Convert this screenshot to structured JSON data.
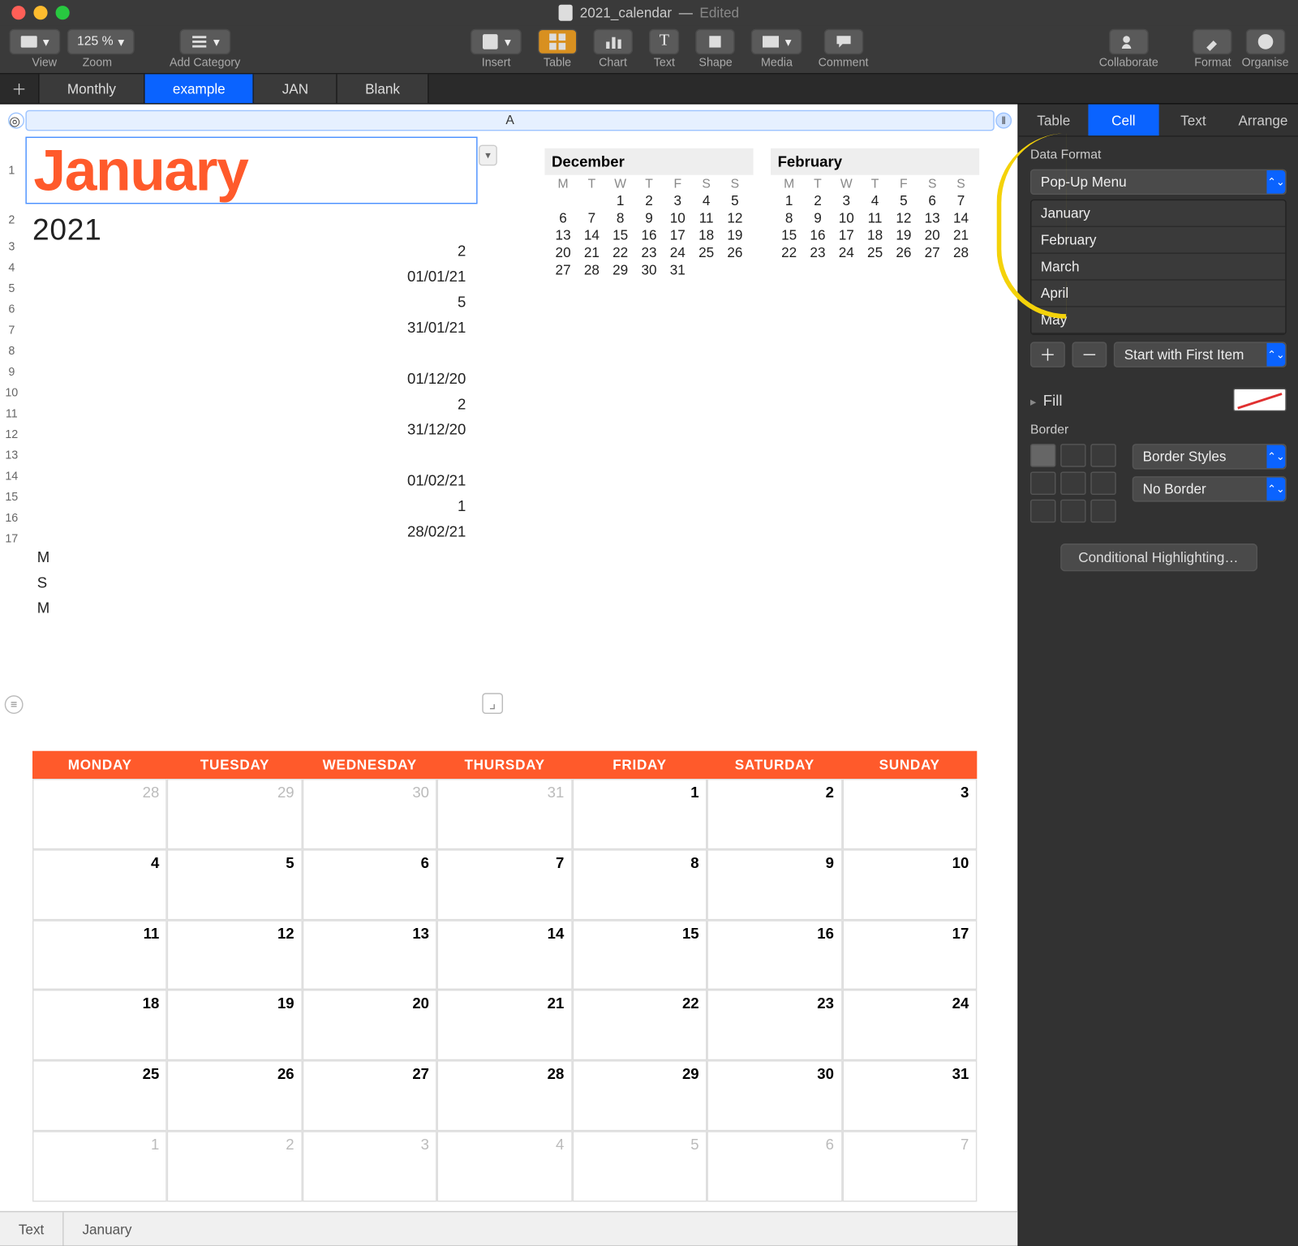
{
  "title": {
    "filename": "2021_calendar",
    "edited": "Edited"
  },
  "toolbar": {
    "view": "View",
    "zoom": "Zoom",
    "zoom_val": "125 %",
    "add_category": "Add Category",
    "insert": "Insert",
    "table": "Table",
    "chart": "Chart",
    "text": "Text",
    "shape": "Shape",
    "media": "Media",
    "comment": "Comment",
    "collaborate": "Collaborate",
    "format": "Format",
    "organise": "Organise"
  },
  "sheets": {
    "items": [
      "Monthly",
      "example",
      "JAN",
      "Blank"
    ],
    "active_index": 1
  },
  "inspector": {
    "tabs": [
      "Table",
      "Cell",
      "Text",
      "Arrange"
    ],
    "active": 1,
    "data_format": "Data Format",
    "format_value": "Pop-Up Menu",
    "options": [
      "January",
      "February",
      "March",
      "April",
      "May"
    ],
    "start_with": "Start with First Item",
    "fill": "Fill",
    "border": "Border",
    "border_styles": "Border Styles",
    "no_border": "No Border",
    "conditional": "Conditional Highlighting…"
  },
  "canvas": {
    "col_letter": "A",
    "cell_title": "January",
    "year": "2021",
    "rows": [
      {
        "n": "3",
        "v": "2"
      },
      {
        "n": "4",
        "v": "01/01/21"
      },
      {
        "n": "5",
        "v": "5"
      },
      {
        "n": "6",
        "v": "31/01/21"
      },
      {
        "n": "7",
        "v": ""
      },
      {
        "n": "8",
        "v": "01/12/20"
      },
      {
        "n": "9",
        "v": "2"
      },
      {
        "n": "10",
        "v": "31/12/20"
      },
      {
        "n": "11",
        "v": ""
      },
      {
        "n": "12",
        "v": "01/02/21"
      },
      {
        "n": "13",
        "v": "1"
      },
      {
        "n": "14",
        "v": "28/02/21"
      },
      {
        "n": "15",
        "v": "M"
      },
      {
        "n": "16",
        "v": "S"
      },
      {
        "n": "17",
        "v": "M"
      }
    ],
    "minical_headers": [
      "M",
      "T",
      "W",
      "T",
      "F",
      "S",
      "S"
    ],
    "december": {
      "title": "December",
      "days": [
        "",
        "",
        "1",
        "2",
        "3",
        "4",
        "5",
        "6",
        "7",
        "8",
        "9",
        "10",
        "11",
        "12",
        "13",
        "14",
        "15",
        "16",
        "17",
        "18",
        "19",
        "20",
        "21",
        "22",
        "23",
        "24",
        "25",
        "26",
        "27",
        "28",
        "29",
        "30",
        "31",
        "",
        ""
      ]
    },
    "february": {
      "title": "February",
      "days": [
        "1",
        "2",
        "3",
        "4",
        "5",
        "6",
        "7",
        "8",
        "9",
        "10",
        "11",
        "12",
        "13",
        "14",
        "15",
        "16",
        "17",
        "18",
        "19",
        "20",
        "21",
        "22",
        "23",
        "24",
        "25",
        "26",
        "27",
        "28",
        "",
        "",
        "",
        "",
        "",
        "",
        ""
      ]
    },
    "weekday_headers": [
      "MONDAY",
      "TUESDAY",
      "WEDNESDAY",
      "THURSDAY",
      "FRIDAY",
      "SATURDAY",
      "SUNDAY"
    ],
    "month_days": [
      {
        "n": "28",
        "o": true
      },
      {
        "n": "29",
        "o": true
      },
      {
        "n": "30",
        "o": true
      },
      {
        "n": "31",
        "o": true
      },
      {
        "n": "1"
      },
      {
        "n": "2"
      },
      {
        "n": "3"
      },
      {
        "n": "4"
      },
      {
        "n": "5"
      },
      {
        "n": "6"
      },
      {
        "n": "7"
      },
      {
        "n": "8"
      },
      {
        "n": "9"
      },
      {
        "n": "10"
      },
      {
        "n": "11"
      },
      {
        "n": "12"
      },
      {
        "n": "13"
      },
      {
        "n": "14"
      },
      {
        "n": "15"
      },
      {
        "n": "16"
      },
      {
        "n": "17"
      },
      {
        "n": "18"
      },
      {
        "n": "19"
      },
      {
        "n": "20"
      },
      {
        "n": "21"
      },
      {
        "n": "22"
      },
      {
        "n": "23"
      },
      {
        "n": "24"
      },
      {
        "n": "25"
      },
      {
        "n": "26"
      },
      {
        "n": "27"
      },
      {
        "n": "28"
      },
      {
        "n": "29"
      },
      {
        "n": "30"
      },
      {
        "n": "31"
      },
      {
        "n": "1",
        "o": true
      },
      {
        "n": "2",
        "o": true
      },
      {
        "n": "3",
        "o": true
      },
      {
        "n": "4",
        "o": true
      },
      {
        "n": "5",
        "o": true
      },
      {
        "n": "6",
        "o": true
      },
      {
        "n": "7",
        "o": true
      }
    ],
    "bottom": {
      "label1": "Text",
      "label2": "January"
    }
  }
}
